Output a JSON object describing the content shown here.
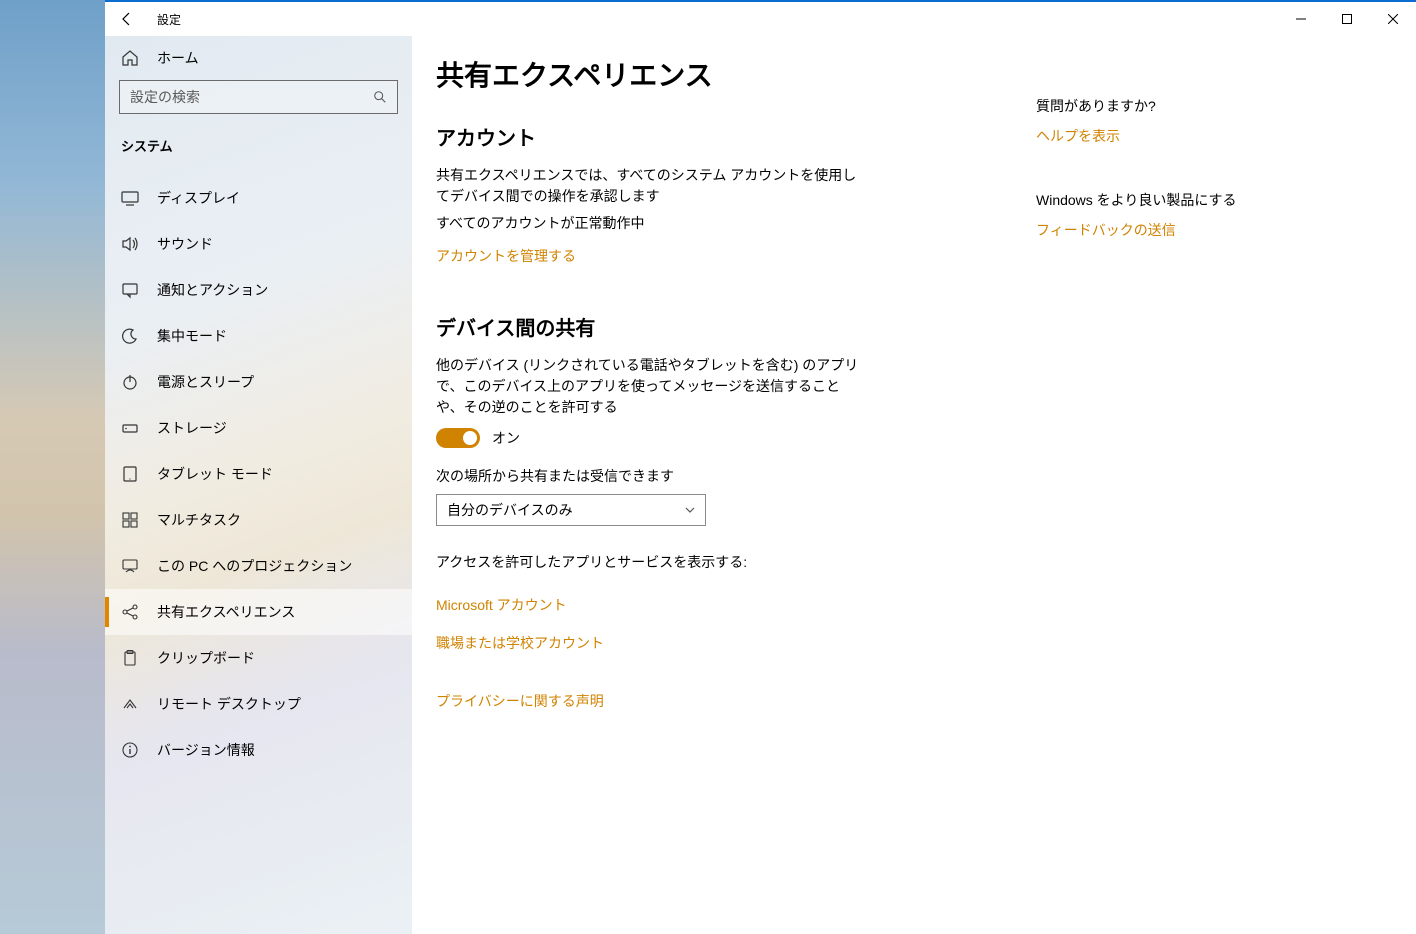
{
  "window": {
    "title": "設定"
  },
  "sidebar": {
    "home_label": "ホーム",
    "search_placeholder": "設定の検索",
    "category_label": "システム",
    "items": [
      {
        "icon": "display",
        "label": "ディスプレイ"
      },
      {
        "icon": "sound",
        "label": "サウンド"
      },
      {
        "icon": "notifications",
        "label": "通知とアクション"
      },
      {
        "icon": "focus",
        "label": "集中モード"
      },
      {
        "icon": "power",
        "label": "電源とスリープ"
      },
      {
        "icon": "storage",
        "label": "ストレージ"
      },
      {
        "icon": "tablet",
        "label": "タブレット モード"
      },
      {
        "icon": "multitask",
        "label": "マルチタスク"
      },
      {
        "icon": "projecting",
        "label": "この PC へのプロジェクション"
      },
      {
        "icon": "shared",
        "label": "共有エクスペリエンス"
      },
      {
        "icon": "clipboard",
        "label": "クリップボード"
      },
      {
        "icon": "remote",
        "label": "リモート デスクトップ"
      },
      {
        "icon": "about",
        "label": "バージョン情報"
      }
    ],
    "active_index": 9
  },
  "main": {
    "page_title": "共有エクスペリエンス",
    "account": {
      "heading": "アカウント",
      "desc": "共有エクスペリエンスでは、すべてのシステム アカウントを使用してデバイス間での操作を承認します",
      "status": "すべてのアカウントが正常動作中",
      "manage_link": "アカウントを管理する"
    },
    "sharing": {
      "heading": "デバイス間の共有",
      "desc": "他のデバイス (リンクされている電話やタブレットを含む) のアプリで、このデバイス上のアプリを使ってメッセージを送信することや、その逆のことを許可する",
      "toggle_state": "オン",
      "select_label": "次の場所から共有または受信できます",
      "select_value": "自分のデバイスのみ",
      "access_label": "アクセスを許可したアプリとサービスを表示する:",
      "ms_account_link": "Microsoft アカウント",
      "work_account_link": "職場または学校アカウント",
      "privacy_link": "プライバシーに関する声明"
    }
  },
  "right": {
    "help_heading": "質問がありますか?",
    "help_link": "ヘルプを表示",
    "feedback_heading": "Windows をより良い製品にする",
    "feedback_link": "フィードバックの送信"
  }
}
